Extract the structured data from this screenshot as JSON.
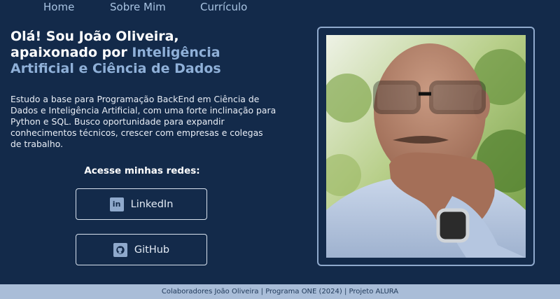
{
  "nav": {
    "items": [
      "Home",
      "Sobre Mim",
      "Currículo"
    ]
  },
  "hero": {
    "headline_line1": "Olá! Sou João Oliveira,",
    "headline_line2_prefix": "apaixonado por ",
    "headline_accent_part1": "Inteligência",
    "headline_accent_part2": "Artificial e Ciência de Dados",
    "bio": "Estudo a base para Programação BackEnd em Ciência de Dados e Inteligência Artificial, com uma forte inclinação para Python e SQL. Busco oportunidade para expandir conhecimentos técnicos, crescer com empresas e colegas de trabalho.",
    "networks_title": "Acesse minhas redes:",
    "linkedin_label": "LinkedIn",
    "github_label": "GitHub"
  },
  "footer": {
    "text": "Colaboradores João Oliveira | Programa ONE (2024) | Projeto ALURA"
  },
  "colors": {
    "background": "#132a4a",
    "accent": "#8fb0d8",
    "footer_bg": "#a9bdd8"
  },
  "icons": [
    "linkedin-icon",
    "github-icon"
  ]
}
